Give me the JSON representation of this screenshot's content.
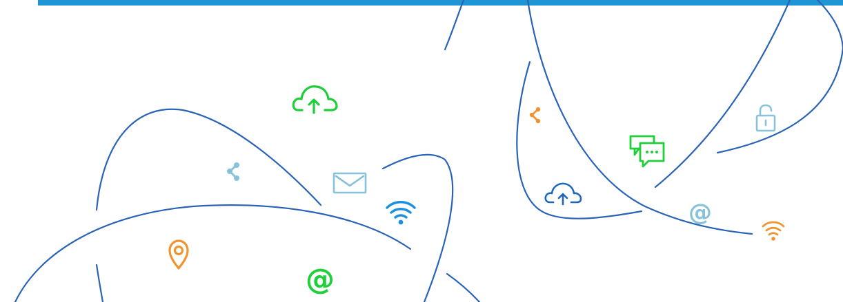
{
  "colors": {
    "top_bar": "#1f96d3",
    "curve": "#2a63b6",
    "green": "#1fcf3a",
    "light_blue": "#87c2d9",
    "blue": "#1b8fe0",
    "orange": "#ef9431",
    "dark_blue": "#1f67ba"
  },
  "icons": {
    "at_symbol": "@",
    "cloud_upload": "cloud-upload-icon",
    "share": "share-icon",
    "mail": "mail-icon",
    "wifi": "wifi-icon",
    "location_pin": "location-pin-icon",
    "padlock": "padlock-icon",
    "chat": "chat-bubbles-icon"
  }
}
